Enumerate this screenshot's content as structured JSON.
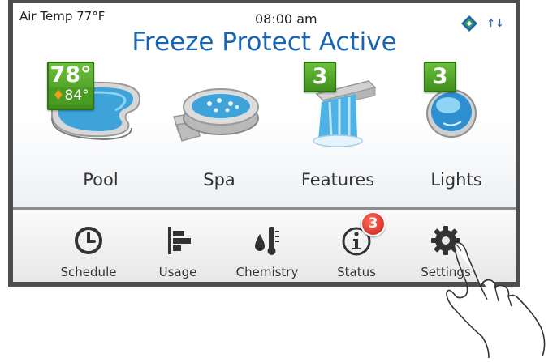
{
  "header": {
    "air_temp": "Air Temp 77°F",
    "time": "08:00 am",
    "title": "Freeze Protect Active"
  },
  "tiles": [
    {
      "label": "Pool",
      "temp": "78°",
      "heat_temp": "84°"
    },
    {
      "label": "Spa"
    },
    {
      "label": "Features",
      "badge": "3"
    },
    {
      "label": "Lights",
      "badge": "3"
    }
  ],
  "nav": [
    {
      "label": "Schedule",
      "icon": "clock-icon"
    },
    {
      "label": "Usage",
      "icon": "usage-bars-icon"
    },
    {
      "label": "Chemistry",
      "icon": "chemistry-icon"
    },
    {
      "label": "Status",
      "icon": "info-icon",
      "alert": "3"
    },
    {
      "label": "Settings",
      "icon": "gear-icon"
    }
  ],
  "icons": {
    "status": [
      "logo-diamond-icon",
      "up-down-arrows-icon"
    ],
    "arrows_glyph": "↑↓"
  },
  "colors": {
    "title_blue": "#1a64b4",
    "badge_green": "#4a9b22",
    "alert_red": "#d4281e",
    "frame": "#4e4e4e"
  }
}
